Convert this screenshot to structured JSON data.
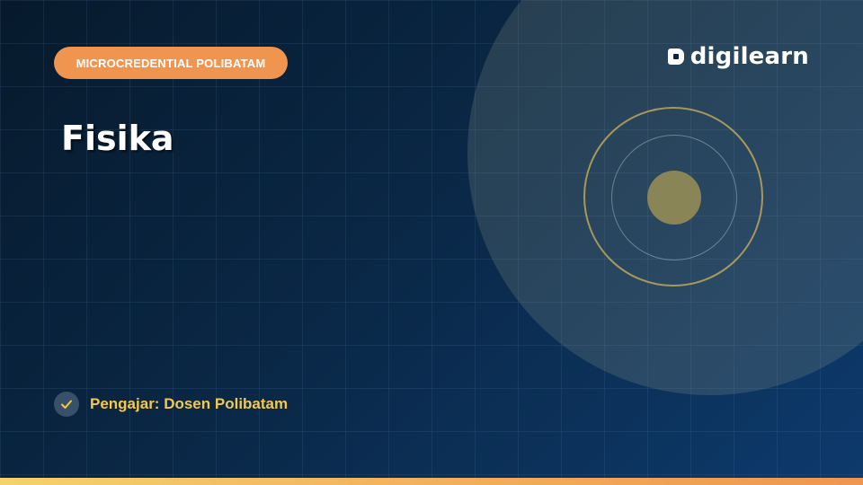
{
  "badge": {
    "label": "MICROCREDENTIAL POLIBATAM"
  },
  "course": {
    "title": "Fisika"
  },
  "brand": {
    "name": "digilearn",
    "icon": "digilearn-logo-icon"
  },
  "instructor": {
    "text": "Pengajar: Dosen Polibatam",
    "icon": "check-icon"
  },
  "colors": {
    "badge_bg": "#f0954f",
    "instructor_text": "#f5c84a",
    "accent_ring": "#d2b45a",
    "background_dark": "#071a2c",
    "background_light": "#0d3a6c"
  }
}
